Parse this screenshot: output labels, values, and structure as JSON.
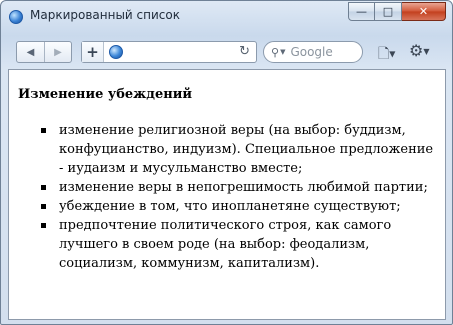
{
  "window": {
    "title": "Маркированный список",
    "minimize_glyph": "—",
    "maximize_glyph": "□",
    "close_glyph": "✕"
  },
  "toolbar": {
    "back_glyph": "◀",
    "forward_glyph": "▶",
    "add_glyph": "+",
    "reload_glyph": "↻",
    "search_placeholder": "Google",
    "search_icon": "search-icon",
    "page_icon": "page-icon",
    "gear_icon": "gear-icon"
  },
  "page": {
    "heading": "Изменение убеждений",
    "items": [
      "изменение религиозной веры (на выбор: буддизм, конфуцианство, индуизм). Специальное предложение - иудаизм и мусульманство вместе;",
      "изменение веры в непогрешимость любимой партии;",
      "убеждение в том, что инопланетяне существуют;",
      "предпочтение политического строя, как самого лучшего в своем роде (на выбор: феодализм, социализм, коммунизм, капитализм)."
    ]
  }
}
